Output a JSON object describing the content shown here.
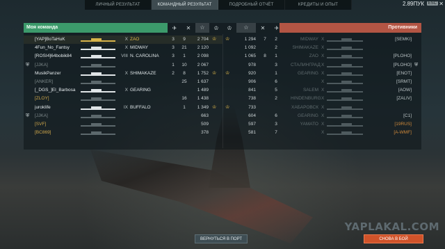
{
  "tabs": [
    {
      "label": "ЛИЧНЫЙ РЕЗУЛЬТАТ",
      "active": false
    },
    {
      "label": "КОМАНДНЫЙ РЕЗУЛЬТАТ",
      "active": true
    },
    {
      "label": "ПОДРОБНЫЙ ОТЧЁТ",
      "active": false
    },
    {
      "label": "КРЕДИТЫ И ОПЫТ",
      "active": false
    }
  ],
  "credits": "2.89ПУК",
  "esc_label": "ESC",
  "my_team_label": "Моя команда",
  "enemy_team_label": "Противники",
  "my_team": [
    {
      "player": "[YAP]BoTaHuK",
      "tier": "X",
      "ship": "ZAO",
      "a": "3",
      "b": "9",
      "xp": "2 704",
      "medal": true,
      "gold": true,
      "dead": false,
      "highlight": true
    },
    {
      "player": "4Fun_No_Fantsy",
      "tier": "X",
      "ship": "MIDWAY",
      "a": "3",
      "b": "21",
      "xp": "2 120",
      "medal": false,
      "gold": false,
      "dead": false
    },
    {
      "player": "[ROSI4]64bobik84",
      "tier": "VIII",
      "ship": "N. CAROLINA",
      "a": "3",
      "b": "1",
      "xp": "2 098",
      "medal": false,
      "gold": false,
      "dead": false
    },
    {
      "player": "[JJKA]",
      "tier": "",
      "ship": "",
      "a": "1",
      "b": "10",
      "xp": "2 067",
      "medal": false,
      "gold": false,
      "dead": true,
      "icon": true
    },
    {
      "player": "MusikPanzer",
      "tier": "X",
      "ship": "SHIMAKAZE",
      "a": "2",
      "b": "8",
      "xp": "1 752",
      "medal": true,
      "gold": false,
      "dead": false
    },
    {
      "player": "[ANKER]",
      "tier": "",
      "ship": "",
      "a": "",
      "b": "25",
      "xp": "1 637",
      "medal": false,
      "gold": false,
      "dead": true
    },
    {
      "player": "[_DGS_]El_Barbosa",
      "tier": "X",
      "ship": "GEARING",
      "a": "",
      "b": "",
      "xp": "1 489",
      "medal": false,
      "gold": false,
      "dead": false
    },
    {
      "player": "[ZLOY]",
      "tier": "",
      "ship": "",
      "a": "",
      "b": "16",
      "xp": "1 438",
      "medal": false,
      "gold": false,
      "dead": true,
      "clan": true
    },
    {
      "player": "jurokIife",
      "tier": "IX",
      "ship": "BUFFALO",
      "a": "",
      "b": "1",
      "xp": "1 349",
      "medal": true,
      "gold": false,
      "dead": false
    },
    {
      "player": "[JJKA]",
      "tier": "",
      "ship": "",
      "a": "",
      "b": "",
      "xp": "663",
      "medal": false,
      "gold": false,
      "dead": true,
      "icon": true
    },
    {
      "player": "[SVF]",
      "tier": "",
      "ship": "",
      "a": "",
      "b": "",
      "xp": "509",
      "medal": false,
      "gold": false,
      "dead": true,
      "clan": true
    },
    {
      "player": "[BC869]",
      "tier": "",
      "ship": "",
      "a": "",
      "b": "",
      "xp": "378",
      "medal": false,
      "gold": false,
      "dead": true,
      "clan": true
    }
  ],
  "enemy_team": [
    {
      "xp": "1 294",
      "a": "7",
      "b": "2",
      "ship": "MIDWAY",
      "tier": "X",
      "player": "[SEMKI]",
      "medal": true,
      "clan": false
    },
    {
      "xp": "1 092",
      "a": "",
      "b": "2",
      "ship": "SHIMAKAZE",
      "tier": "X",
      "player": "",
      "medal": false,
      "clan": false
    },
    {
      "xp": "1 065",
      "a": "8",
      "b": "1",
      "ship": "ZAO",
      "tier": "X",
      "player": "[PLOHO]",
      "medal": false,
      "clan": false
    },
    {
      "xp": "978",
      "a": "",
      "b": "3",
      "ship": "СТАЛИНГРАД",
      "tier": "X",
      "player": "[PLOHO]",
      "medal": false,
      "clan": false,
      "icon": true
    },
    {
      "xp": "920",
      "a": "",
      "b": "1",
      "ship": "GEARING",
      "tier": "X",
      "player": "[ENOT]",
      "medal": true,
      "clan": false
    },
    {
      "xp": "906",
      "a": "",
      "b": "6",
      "ship": "",
      "tier": "X",
      "player": "[SRMT]",
      "medal": false,
      "clan": false
    },
    {
      "xp": "841",
      "a": "",
      "b": "5",
      "ship": "SALEM",
      "tier": "X",
      "player": "[AOW]",
      "medal": false,
      "clan": false
    },
    {
      "xp": "738",
      "a": "",
      "b": "2",
      "ship": "HINDENBURG",
      "tier": "X",
      "player": "[ZALIV]",
      "medal": false,
      "clan": false
    },
    {
      "xp": "733",
      "a": "",
      "b": "",
      "ship": "ХАБАРОВСК",
      "tier": "X",
      "player": "",
      "medal": true,
      "clan": false
    },
    {
      "xp": "604",
      "a": "",
      "b": "6",
      "ship": "GEARING",
      "tier": "X",
      "player": "[C1]",
      "medal": false,
      "clan": false
    },
    {
      "xp": "597",
      "a": "",
      "b": "3",
      "ship": "YAMATO",
      "tier": "X",
      "player": "[19RUS]",
      "medal": false,
      "clan": true
    },
    {
      "xp": "581",
      "a": "",
      "b": "7",
      "ship": "",
      "tier": "X",
      "player": "[A-WMF]",
      "medal": false,
      "clan": true
    }
  ],
  "buttons": {
    "port": "ВЕРНУТЬСЯ В ПОРТ",
    "again": "СНОВА В БОЙ"
  },
  "watermark": "YAPLAKAL.COM"
}
